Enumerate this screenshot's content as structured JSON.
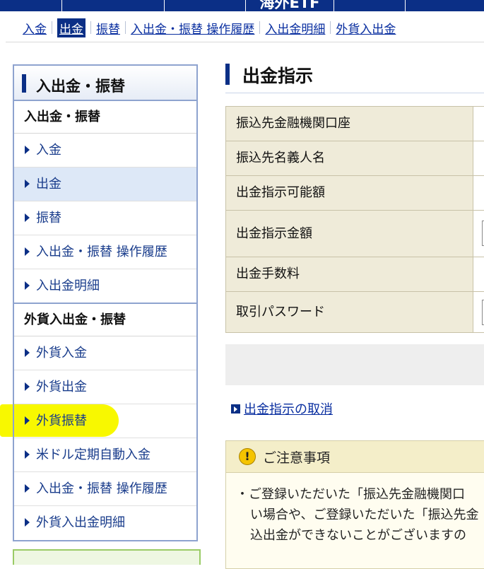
{
  "top_nav": {
    "tabs": [
      {
        "label": ""
      },
      {
        "label": ""
      },
      {
        "label": ""
      },
      {
        "label": "海外ETF"
      },
      {
        "label": ""
      },
      {
        "label": ""
      }
    ]
  },
  "sub_nav": {
    "items": [
      {
        "label": "入金",
        "active": false
      },
      {
        "label": "出金",
        "active": true
      },
      {
        "label": "振替",
        "active": false
      },
      {
        "label": "入出金・振替 操作履歴",
        "active": false
      },
      {
        "label": "入出金明細",
        "active": false
      },
      {
        "label": "外貨入出金",
        "active": false
      }
    ]
  },
  "sidebar": {
    "title": "入出金・振替",
    "sections": [
      {
        "heading": "入出金・振替",
        "items": [
          {
            "label": "入金"
          },
          {
            "label": "出金"
          },
          {
            "label": "振替"
          },
          {
            "label": "入出金・振替 操作履歴"
          },
          {
            "label": "入出金明細"
          }
        ]
      },
      {
        "heading": "外貨入出金・振替",
        "items": [
          {
            "label": "外貨入金"
          },
          {
            "label": "外貨出金"
          },
          {
            "label": "外貨振替"
          },
          {
            "label": "米ドル定期自動入金"
          },
          {
            "label": "入出金・振替 操作履歴"
          },
          {
            "label": "外貨入出金明細"
          }
        ]
      }
    ]
  },
  "main": {
    "title": "出金指示",
    "form_rows": [
      {
        "label": "振込先金融機関口座",
        "value": ""
      },
      {
        "label": "振込先名義人名",
        "value": ""
      },
      {
        "label": "出金指示可能額",
        "value": ""
      },
      {
        "label": "出金指示金額",
        "value": ""
      },
      {
        "label": "出金手数料",
        "value": ""
      },
      {
        "label": "取引パスワード",
        "value": ""
      }
    ],
    "cancel_link": "出金指示の取消",
    "notice": {
      "title": "ご注意事項",
      "lines": [
        "・ご登録いただいた「振込先金融機関口",
        "い場合や、ご登録いただいた「振込先金",
        "込出金ができないことがございますの"
      ]
    }
  },
  "colors": {
    "nav_blue": "#0b2f86",
    "link_blue": "#0a2fa0",
    "label_bg": "#efebd9",
    "highlight": "#f8f800"
  }
}
